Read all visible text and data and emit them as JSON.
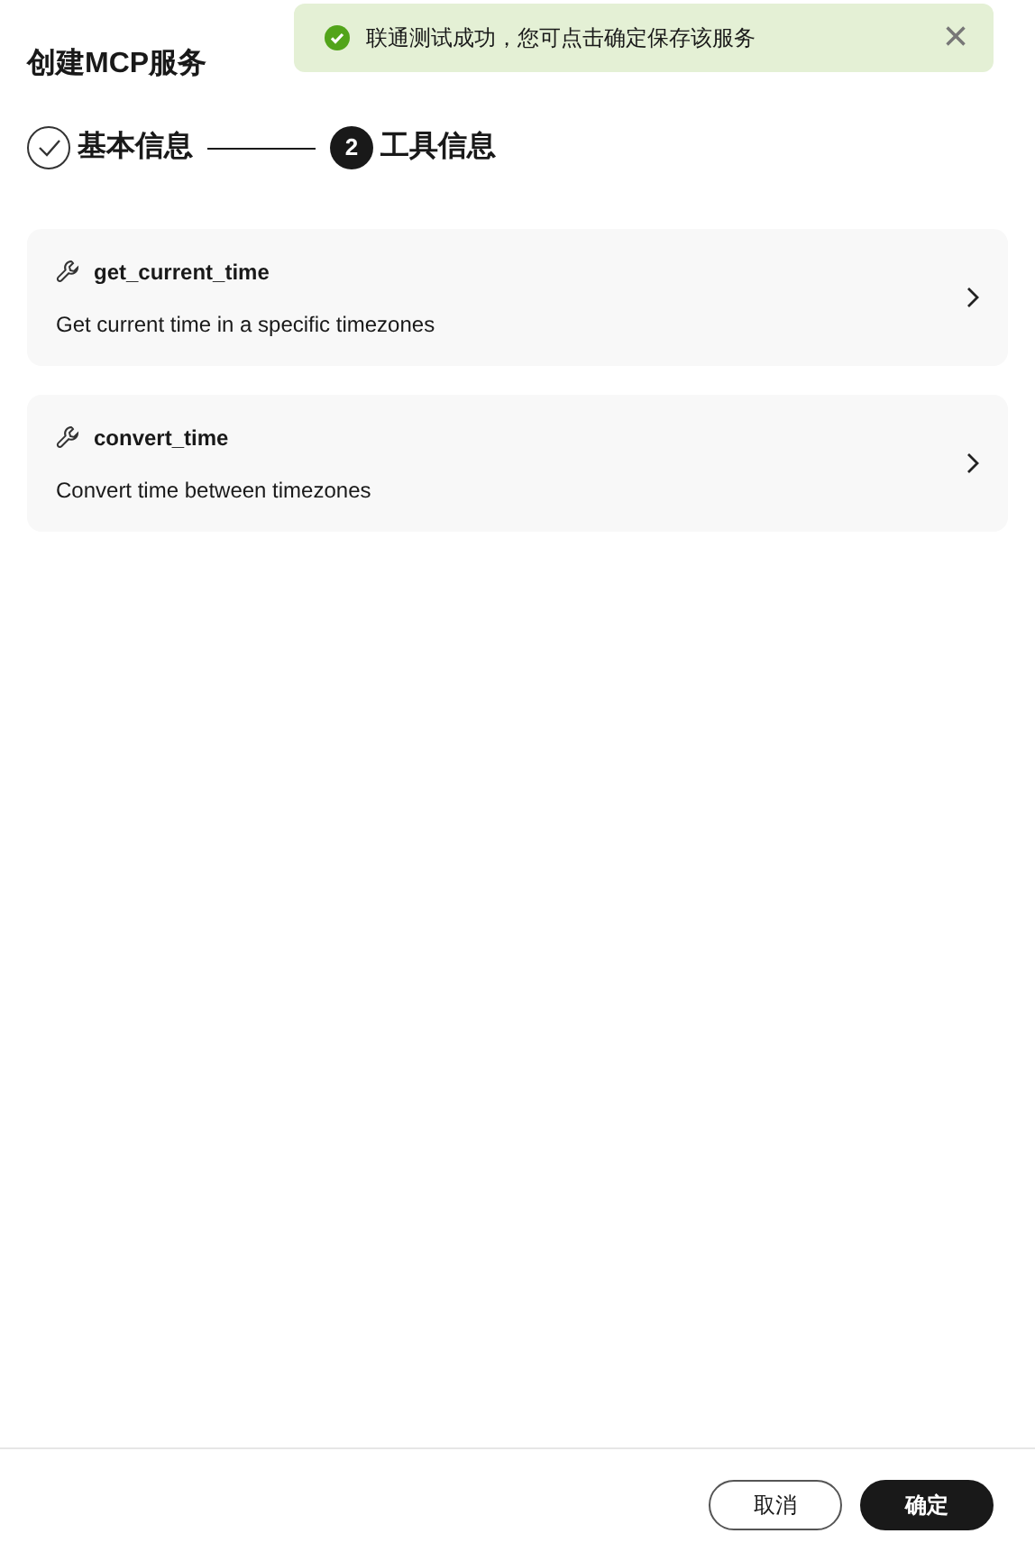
{
  "title": "创建MCP服务",
  "toast": {
    "kind": "success",
    "message": "联通测试成功，您可点击确定保存该服务",
    "close": "×"
  },
  "steps": [
    {
      "completed": true,
      "label": "基本信息"
    },
    {
      "completed": false,
      "number": "2",
      "label": "工具信息"
    }
  ],
  "tools": [
    {
      "name": "get_current_time",
      "description": "Get current time in a specific timezones"
    },
    {
      "name": "convert_time",
      "description": "Convert time between timezones"
    }
  ],
  "buttons": [
    {
      "kind": "secondary",
      "label": "取消"
    },
    {
      "kind": "primary",
      "label": "确定"
    }
  ]
}
